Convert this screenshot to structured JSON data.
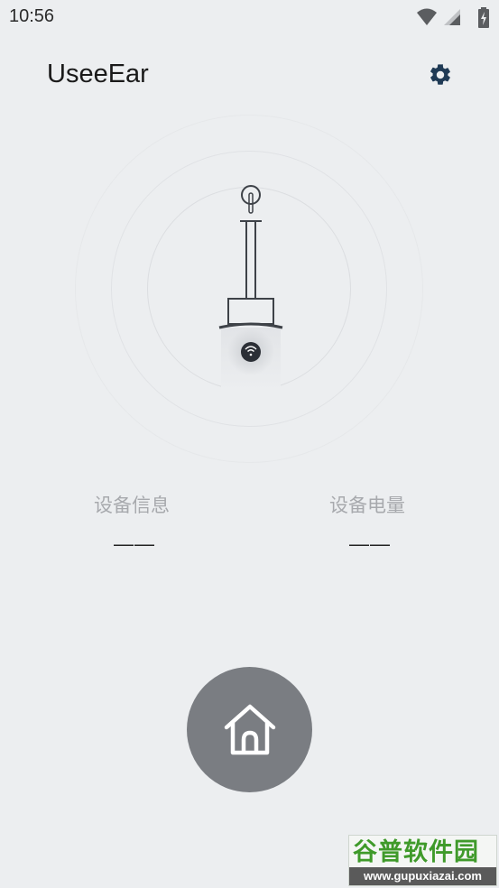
{
  "status_bar": {
    "time": "10:56",
    "icons": [
      "wifi-icon",
      "cell-signal-icon",
      "battery-charging-icon"
    ]
  },
  "app_bar": {
    "title": "UseeEar",
    "settings_icon": "gear-icon"
  },
  "device": {
    "status_icon": "wifi-icon"
  },
  "info": {
    "device_info_label": "设备信息",
    "device_info_value": "——",
    "battery_label": "设备电量",
    "battery_value": "——"
  },
  "home_button": {
    "icon": "home-icon"
  },
  "watermark": {
    "brand": "谷普软件园",
    "url": "www.gupuxiazai.com"
  },
  "colors": {
    "background": "#eceef0",
    "home_button": "#7a7d82",
    "watermark_green": "#3f9a2a"
  }
}
